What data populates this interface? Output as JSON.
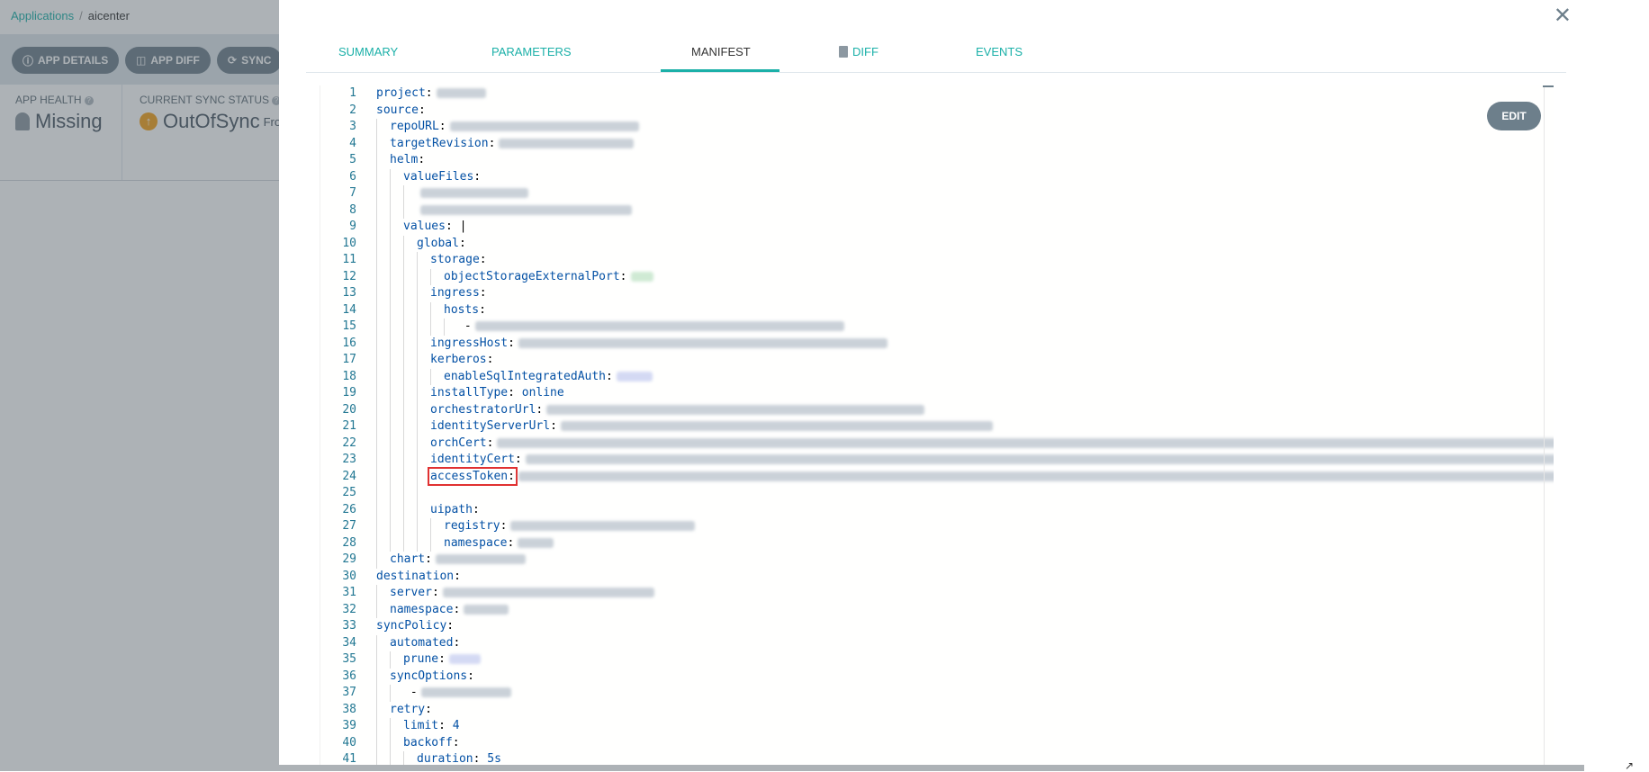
{
  "breadcrumb": {
    "root": "Applications",
    "current": "aicenter"
  },
  "toolbar": {
    "app_details": "APP DETAILS",
    "app_diff": "APP DIFF",
    "sync": "SYNC"
  },
  "status": {
    "health_label": "APP HEALTH",
    "health_value": "Missing",
    "sync_label": "CURRENT SYNC STATUS",
    "sync_value": "OutOfSync",
    "sync_suffix": "Fro"
  },
  "panel": {
    "close_icon": "close-icon",
    "tabs": [
      {
        "label": "SUMMARY"
      },
      {
        "label": "PARAMETERS"
      },
      {
        "label": "MANIFEST"
      },
      {
        "label": "DIFF"
      },
      {
        "label": "EVENTS"
      }
    ],
    "active_tab": "MANIFEST",
    "edit_label": "EDIT"
  },
  "manifest": {
    "lines": [
      {
        "n": "1",
        "d": 0,
        "k": "project",
        "v": ""
      },
      {
        "n": "2",
        "d": 0,
        "k": "source",
        "v": ""
      },
      {
        "n": "3",
        "d": 1,
        "k": "repoURL",
        "v": ""
      },
      {
        "n": "4",
        "d": 1,
        "k": "targetRevision",
        "v": ""
      },
      {
        "n": "5",
        "d": 1,
        "k": "helm",
        "v": ""
      },
      {
        "n": "6",
        "d": 2,
        "k": "valueFiles",
        "v": ""
      },
      {
        "n": "7",
        "d": 3,
        "k": "",
        "v": ""
      },
      {
        "n": "8",
        "d": 3,
        "k": "",
        "v": ""
      },
      {
        "n": "9",
        "d": 2,
        "k": "values",
        "v": "|"
      },
      {
        "n": "10",
        "d": 3,
        "k": "global",
        "v": ""
      },
      {
        "n": "11",
        "d": 4,
        "k": "storage",
        "v": ""
      },
      {
        "n": "12",
        "d": 5,
        "k": "objectStorageExternalPort",
        "v": ""
      },
      {
        "n": "13",
        "d": 4,
        "k": "ingress",
        "v": ""
      },
      {
        "n": "14",
        "d": 5,
        "k": "hosts",
        "v": ""
      },
      {
        "n": "15",
        "d": 6,
        "k": "",
        "v": "-"
      },
      {
        "n": "16",
        "d": 4,
        "k": "ingressHost",
        "v": ""
      },
      {
        "n": "17",
        "d": 4,
        "k": "kerberos",
        "v": ""
      },
      {
        "n": "18",
        "d": 5,
        "k": "enableSqlIntegratedAuth",
        "v": ""
      },
      {
        "n": "19",
        "d": 4,
        "k": "installType",
        "v": "online"
      },
      {
        "n": "20",
        "d": 4,
        "k": "orchestratorUrl",
        "v": ""
      },
      {
        "n": "21",
        "d": 4,
        "k": "identityServerUrl",
        "v": ""
      },
      {
        "n": "22",
        "d": 4,
        "k": "orchCert",
        "v": ""
      },
      {
        "n": "23",
        "d": 4,
        "k": "identityCert",
        "v": ""
      },
      {
        "n": "24",
        "d": 4,
        "k": "accessToken",
        "v": ""
      },
      {
        "n": "25",
        "d": 4,
        "k": "",
        "v": ""
      },
      {
        "n": "26",
        "d": 4,
        "k": "uipath",
        "v": ""
      },
      {
        "n": "27",
        "d": 5,
        "k": "registry",
        "v": ""
      },
      {
        "n": "28",
        "d": 5,
        "k": "namespace",
        "v": ""
      },
      {
        "n": "29",
        "d": 1,
        "k": "chart",
        "v": ""
      },
      {
        "n": "30",
        "d": 0,
        "k": "destination",
        "v": ""
      },
      {
        "n": "31",
        "d": 1,
        "k": "server",
        "v": ""
      },
      {
        "n": "32",
        "d": 1,
        "k": "namespace",
        "v": ""
      },
      {
        "n": "33",
        "d": 0,
        "k": "syncPolicy",
        "v": ""
      },
      {
        "n": "34",
        "d": 1,
        "k": "automated",
        "v": ""
      },
      {
        "n": "35",
        "d": 2,
        "k": "prune",
        "v": ""
      },
      {
        "n": "36",
        "d": 1,
        "k": "syncOptions",
        "v": ""
      },
      {
        "n": "37",
        "d": 2,
        "k": "",
        "v": "-"
      },
      {
        "n": "38",
        "d": 1,
        "k": "retry",
        "v": ""
      },
      {
        "n": "39",
        "d": 2,
        "k": "limit",
        "v": "4"
      },
      {
        "n": "40",
        "d": 2,
        "k": "backoff",
        "v": ""
      },
      {
        "n": "41",
        "d": 3,
        "k": "duration",
        "v": "5s"
      }
    ],
    "highlighted_key": "accessToken"
  },
  "colors": {
    "accent": "#1bb0a8",
    "button": "#6d7f8b",
    "warning": "#f4a018",
    "highlight": "#e03131"
  }
}
